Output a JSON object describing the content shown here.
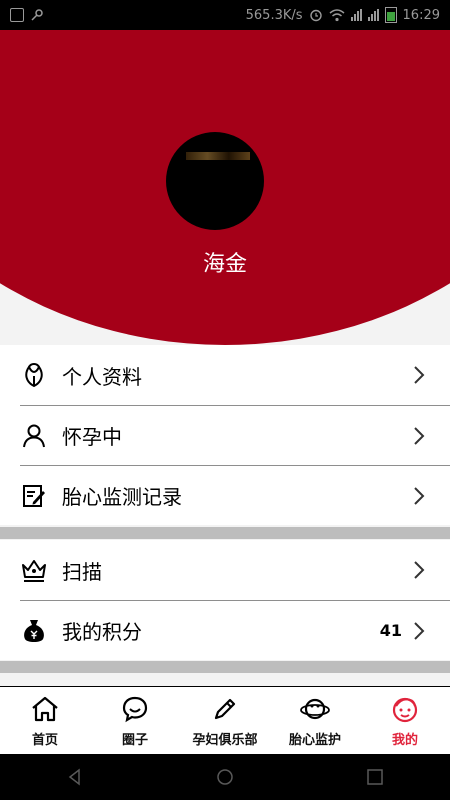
{
  "status": {
    "speed": "565.3K/s",
    "time": "16:29"
  },
  "profile": {
    "name": "海金"
  },
  "menu": {
    "group1": [
      {
        "label": "个人资料",
        "icon": "leaf-icon"
      },
      {
        "label": "怀孕中",
        "icon": "person-icon"
      },
      {
        "label": "胎心监测记录",
        "icon": "edit-document-icon"
      }
    ],
    "group2": [
      {
        "label": "扫描",
        "icon": "scan-crown-icon"
      },
      {
        "label": "我的积分",
        "icon": "money-bag-icon",
        "value": "41"
      }
    ]
  },
  "tabs": [
    {
      "label": "首页",
      "icon": "home-icon"
    },
    {
      "label": "圈子",
      "icon": "chat-bubble-icon"
    },
    {
      "label": "孕妇俱乐部",
      "icon": "pencil-icon"
    },
    {
      "label": "胎心监护",
      "icon": "planet-icon"
    },
    {
      "label": "我的",
      "icon": "baby-face-icon",
      "active": true
    }
  ],
  "colors": {
    "header": "#a50018",
    "active_tab": "#e0243c"
  }
}
